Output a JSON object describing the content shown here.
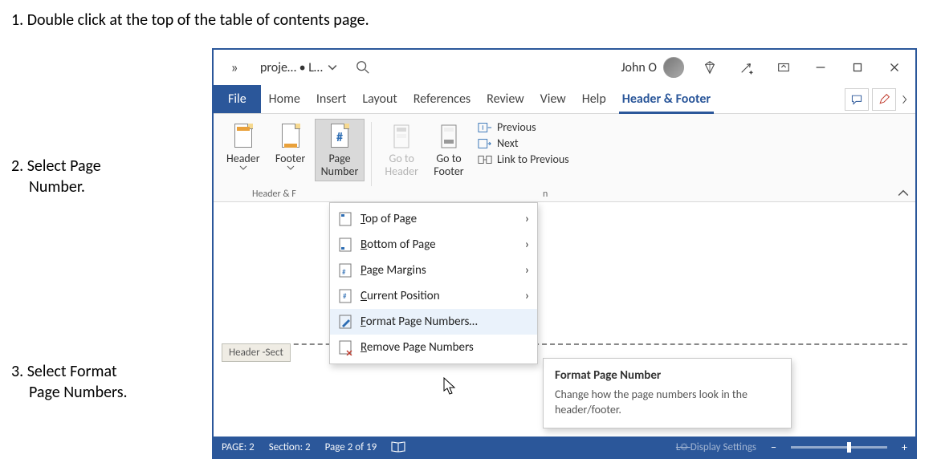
{
  "instructions": {
    "i1": "1. Double click at the top of the table of contents page.",
    "i2a": "2. Select Page",
    "i2b": "Number.",
    "i3a": "3. Select Format",
    "i3b": "Page Numbers."
  },
  "titlebar": {
    "more": "»",
    "doc": "proje… • L…",
    "user": "John O"
  },
  "tabs": {
    "file": "File",
    "home": "Home",
    "insert": "Insert",
    "layout": "Layout",
    "references": "References",
    "review": "Review",
    "view": "View",
    "help": "Help",
    "hf": "Header & Footer"
  },
  "ribbon": {
    "header": "Header",
    "footer": "Footer",
    "page_number": "Page\nNumber",
    "goto_header": "Go to\nHeader",
    "goto_footer": "Go to\nFooter",
    "previous": "Previous",
    "next": "Next",
    "link": "Link to Previous",
    "group_hf": "Header & F",
    "group_nav_cut": "n"
  },
  "dropdown": {
    "top": "op of Page",
    "top_u": "T",
    "bottom_u": "B",
    "bottom": "ottom of Page",
    "margins_u": "P",
    "margins": "age Margins",
    "current_u": "C",
    "current": "urrent Position",
    "format_u": "F",
    "format": "ormat Page Numbers…",
    "remove_u": "R",
    "remove": "emove Page Numbers"
  },
  "tooltip": {
    "title": "Format Page Number",
    "body": "Change how the page numbers look in the header/footer."
  },
  "doc": {
    "header_tab": "Header -Sect"
  },
  "status": {
    "page": "PAGE: 2",
    "section": "Section: 2",
    "pages": "Page 2 of 19",
    "display": "Display Settings"
  }
}
